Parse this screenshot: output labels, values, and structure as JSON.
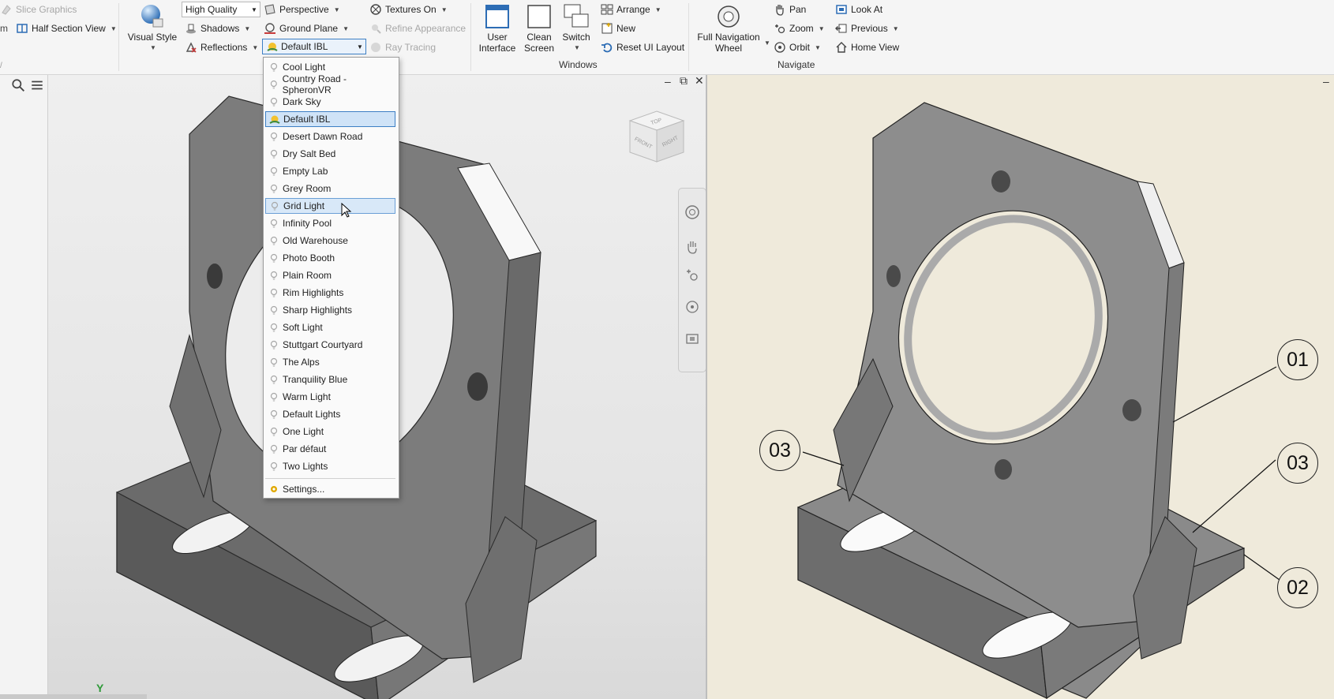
{
  "ribbon": {
    "slice_graphics": "Slice Graphics",
    "half_section_view": "Half Section View",
    "visual_style": "Visual Style",
    "quality": "High Quality",
    "shadows": "Shadows",
    "reflections": "Reflections",
    "perspective": "Perspective",
    "ground_plane": "Ground Plane",
    "ibl_value": "Default IBL",
    "textures": "Textures On",
    "refine_appearance": "Refine Appearance",
    "ray_tracing": "Ray Tracing",
    "user_interface": "User\nInterface",
    "clean_screen": "Clean\nScreen",
    "switch": "Switch",
    "arrange": "Arrange",
    "new": "New",
    "reset_ui_layout": "Reset UI Layout",
    "windows_group": "Windows",
    "full_navigation_wheel": "Full Navigation\nWheel",
    "pan": "Pan",
    "zoom": "Zoom",
    "orbit": "Orbit",
    "look_at": "Look At",
    "previous": "Previous",
    "home_view": "Home View",
    "navigate_group": "Navigate"
  },
  "ibl_dropdown": {
    "items": [
      {
        "label": "Cool Light",
        "state": "normal"
      },
      {
        "label": "Country Road - SpheronVR",
        "state": "normal"
      },
      {
        "label": "Dark Sky",
        "state": "normal"
      },
      {
        "label": "Default IBL",
        "state": "selected"
      },
      {
        "label": "Desert Dawn Road",
        "state": "normal"
      },
      {
        "label": "Dry Salt Bed",
        "state": "normal"
      },
      {
        "label": "Empty Lab",
        "state": "normal"
      },
      {
        "label": "Grey Room",
        "state": "normal"
      },
      {
        "label": "Grid Light",
        "state": "hover"
      },
      {
        "label": "Infinity Pool",
        "state": "normal"
      },
      {
        "label": "Old Warehouse",
        "state": "normal"
      },
      {
        "label": "Photo Booth",
        "state": "normal"
      },
      {
        "label": "Plain Room",
        "state": "normal"
      },
      {
        "label": "Rim Highlights",
        "state": "normal"
      },
      {
        "label": "Sharp Highlights",
        "state": "normal"
      },
      {
        "label": "Soft Light",
        "state": "normal"
      },
      {
        "label": "Stuttgart Courtyard",
        "state": "normal"
      },
      {
        "label": "The Alps",
        "state": "normal"
      },
      {
        "label": "Tranquility Blue",
        "state": "normal"
      },
      {
        "label": "Warm Light",
        "state": "normal"
      },
      {
        "label": "Default Lights",
        "state": "normal"
      },
      {
        "label": "One Light",
        "state": "normal"
      },
      {
        "label": "Par défaut",
        "state": "normal"
      },
      {
        "label": "Two Lights",
        "state": "normal"
      }
    ],
    "settings": "Settings..."
  },
  "viewcube": {
    "top": "TOP",
    "front": "FRONT",
    "right": "RIGHT"
  },
  "axis_label": "Y",
  "balloons": [
    "01",
    "03",
    "03",
    "02"
  ],
  "colors": {
    "selection": "#cfe3f7",
    "selection_border": "#3d7fc4",
    "drawing_bg": "#efeadb",
    "axis": "#2e9a38"
  }
}
